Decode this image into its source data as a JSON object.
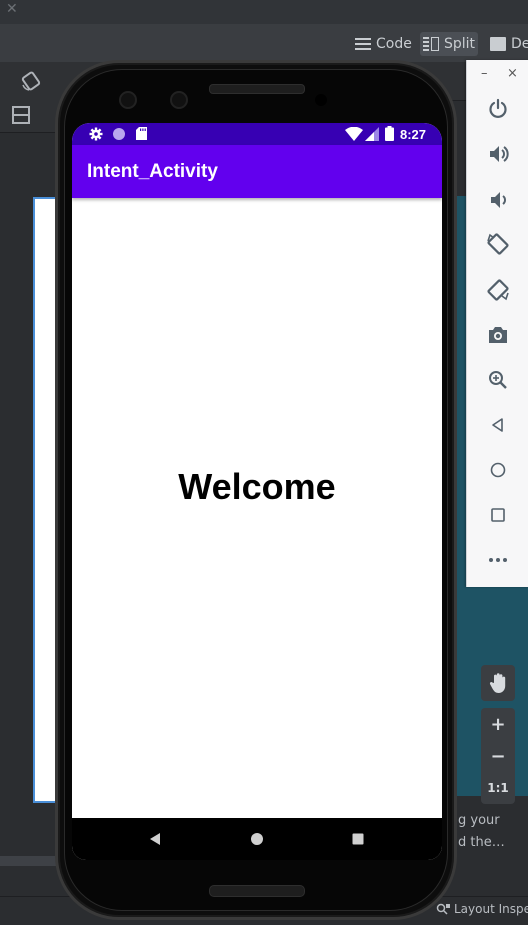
{
  "ide": {
    "view_modes": [
      {
        "label": "Code",
        "icon": "lines-icon"
      },
      {
        "label": "Split",
        "icon": "split-icon",
        "active": true
      },
      {
        "label": "De",
        "icon": "image-icon"
      }
    ],
    "hint_line1": "g your",
    "hint_line2": "d the…",
    "status_item": "Layout Inspe"
  },
  "emulator_panel": {
    "min_label": "–",
    "close_label": "×",
    "buttons": [
      "power-icon",
      "volume-up-icon",
      "volume-down-icon",
      "rotate-left-icon",
      "rotate-right-icon",
      "camera-icon",
      "zoom-icon",
      "back-icon",
      "home-icon",
      "overview-icon",
      "more-icon"
    ]
  },
  "zoom_controls": {
    "plus": "+",
    "minus": "−",
    "one_to_one": "1:1"
  },
  "phone": {
    "status_bar": {
      "time": "8:27"
    },
    "app_bar": {
      "title": "Intent_Activity"
    },
    "content": {
      "welcome_text": "Welcome"
    }
  },
  "colors": {
    "status_bar": "#3700b3",
    "app_bar": "#6200ee",
    "ide_background": "#2b2d30",
    "emulator_teal": "#1e5364"
  }
}
